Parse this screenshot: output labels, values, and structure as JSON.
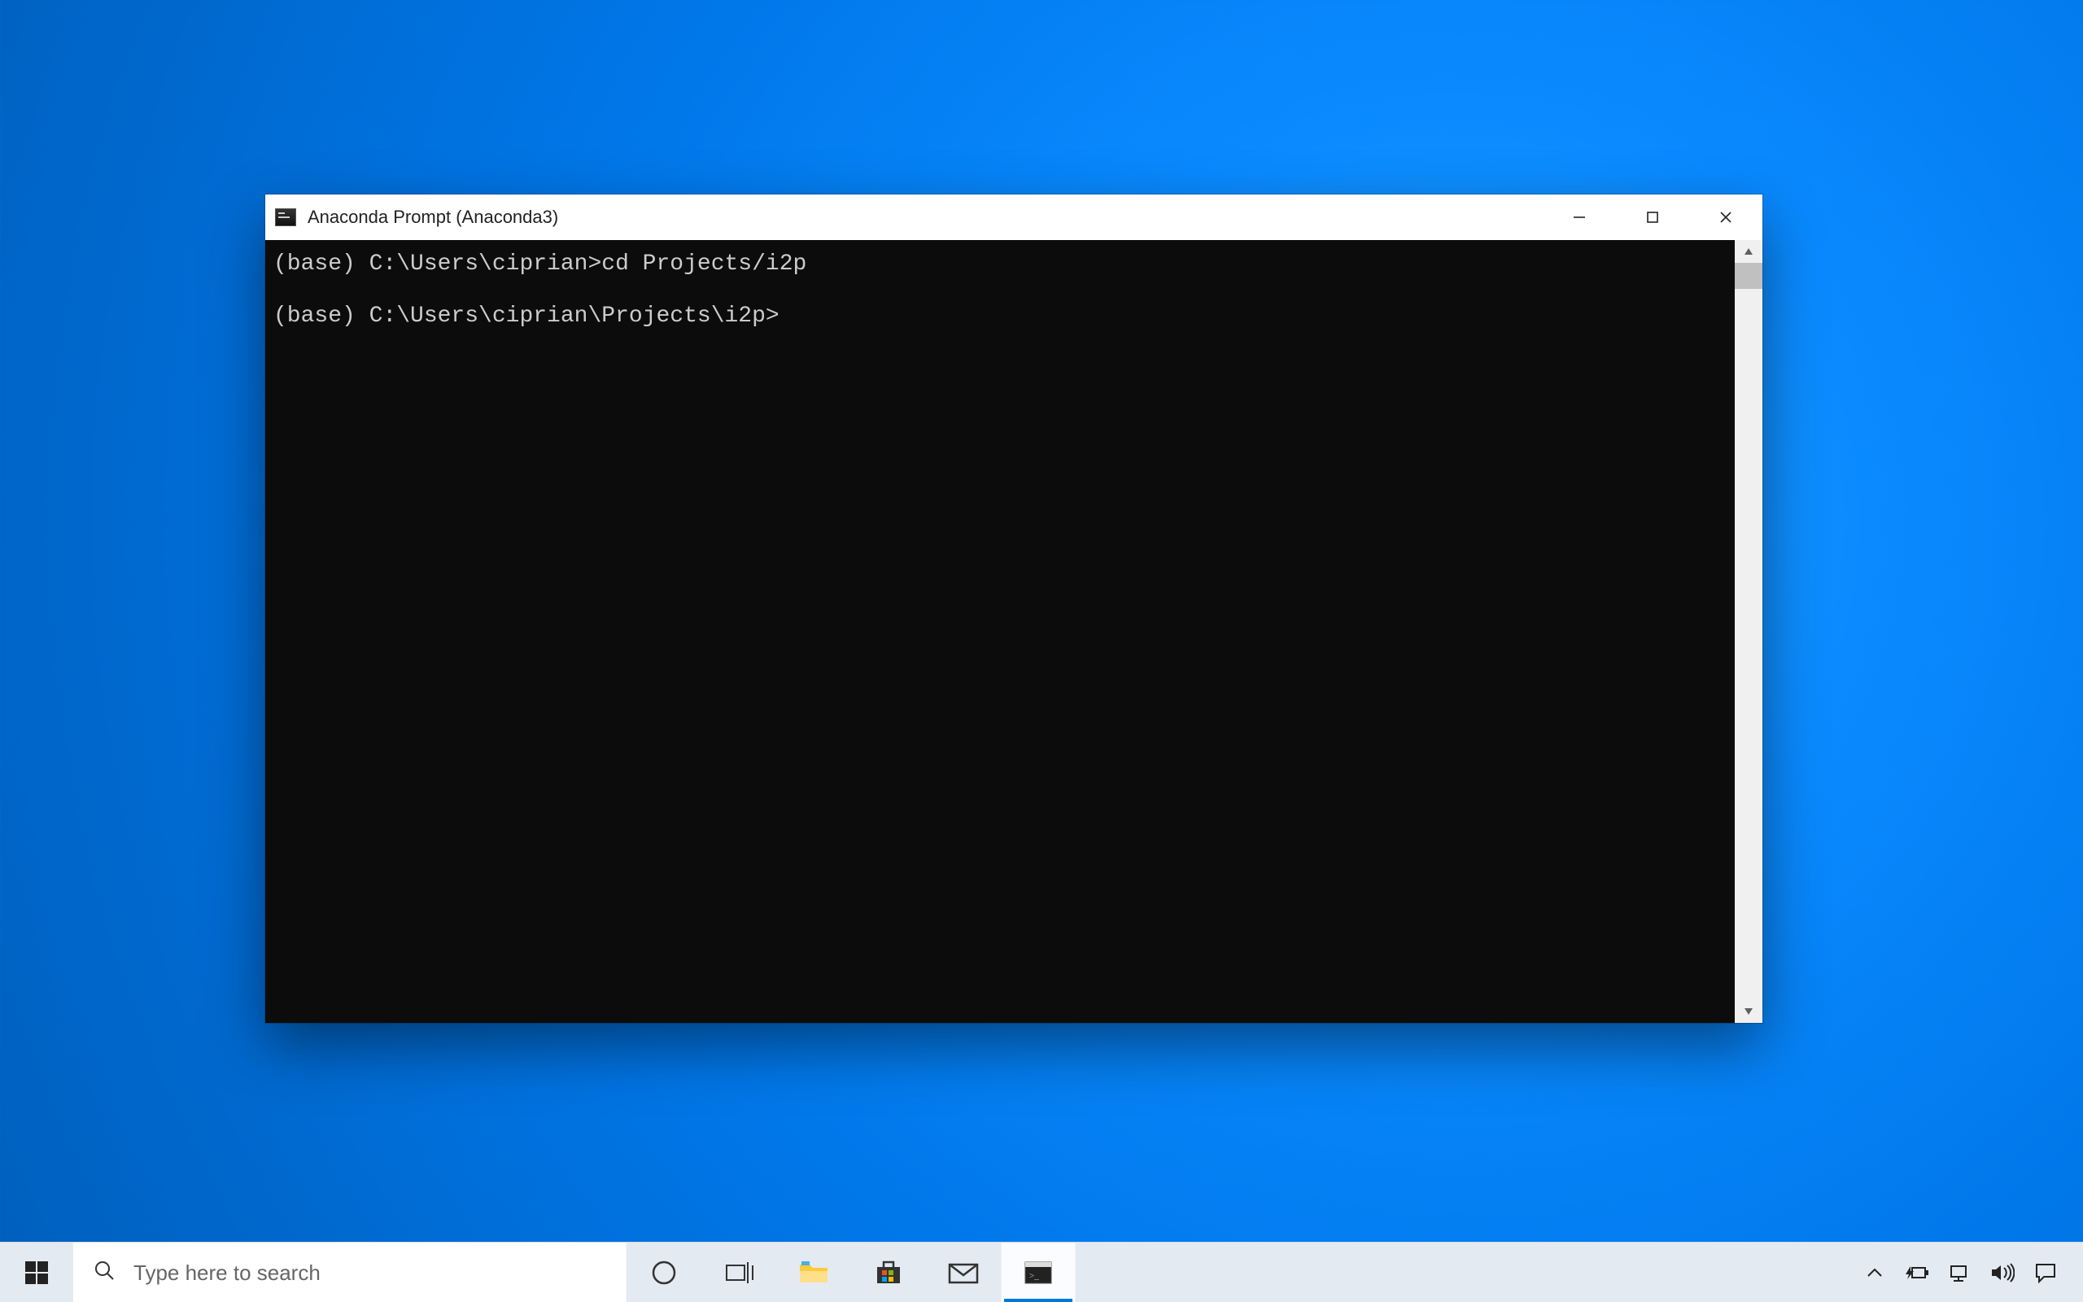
{
  "window": {
    "title": "Anaconda Prompt (Anaconda3)",
    "controls": {
      "minimize": "–",
      "maximize": "□",
      "close": "✕"
    }
  },
  "terminal": {
    "lines": [
      "(base) C:\\Users\\ciprian>cd Projects/i2p",
      "",
      "(base) C:\\Users\\ciprian\\Projects\\i2p>"
    ]
  },
  "taskbar": {
    "search_placeholder": "Type here to search",
    "tray": {
      "icons": [
        "chevron-up",
        "battery",
        "network",
        "volume",
        "action-center"
      ]
    }
  }
}
